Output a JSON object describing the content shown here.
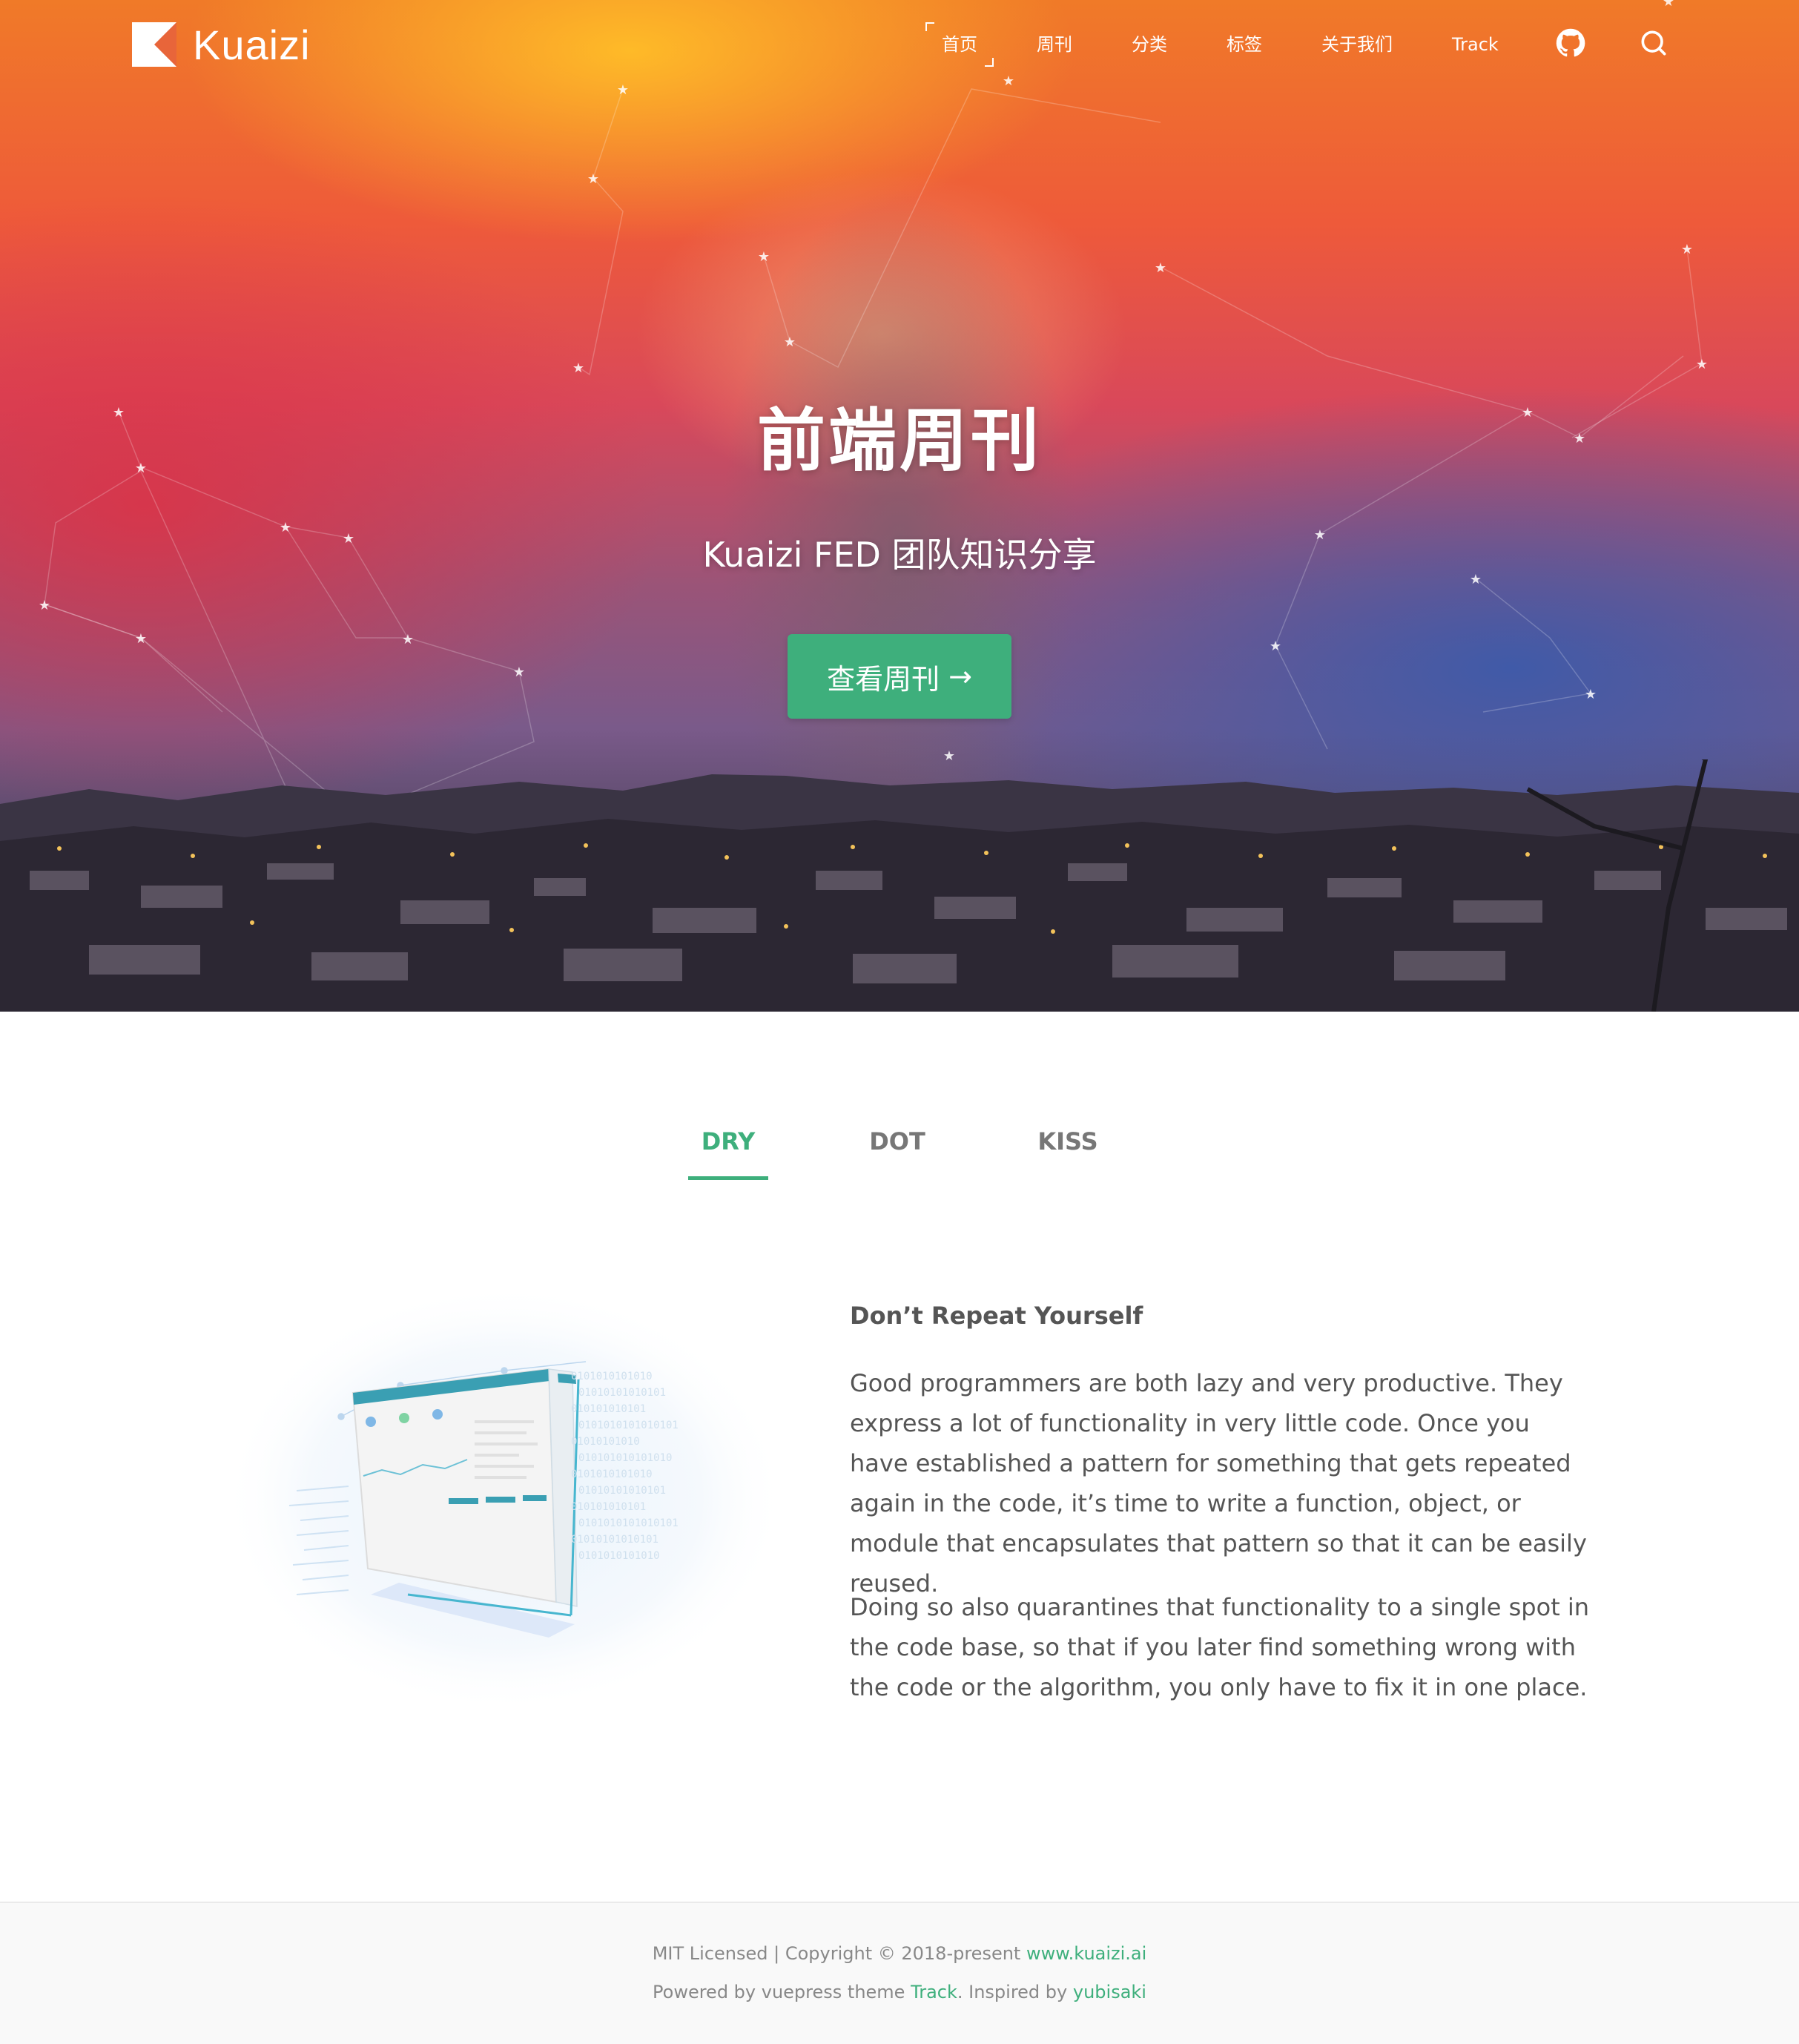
{
  "colors": {
    "accent": "#3eaf7c",
    "text": "#555555",
    "footer_bg": "#f9f9f9"
  },
  "header": {
    "brand": "Kuaizi",
    "nav": [
      {
        "label": "首页",
        "active": true
      },
      {
        "label": "周刊"
      },
      {
        "label": "分类"
      },
      {
        "label": "标签"
      },
      {
        "label": "关于我们"
      },
      {
        "label": "Track"
      }
    ],
    "icons": [
      "github-icon",
      "search-icon"
    ]
  },
  "hero": {
    "title": "前端周刊",
    "subtitle": "Kuaizi FED 团队知识分享",
    "button_label": "查看周刊",
    "button_arrow": "→"
  },
  "tabs": [
    {
      "label": "DRY",
      "active": true
    },
    {
      "label": "DOT"
    },
    {
      "label": "KISS"
    }
  ],
  "feature": {
    "title": "Don’t Repeat Yourself",
    "paragraphs": [
      "Good programmers are both lazy and very productive. They express a lot of functionality in very little code. Once you have established a pattern for something that gets repeated again in the code, it’s time to write a function, object, or module that encapsulates that pattern so that it can be easily reused.",
      "Doing so also quarantines that functionality to a single spot in the code base, so that if you later find something wrong with the code or the algorithm, you only have to fix it in one place."
    ],
    "illustration_binary": [
      "0101010101010",
      "01010101010101",
      "010101010101",
      "0101010101010101",
      "01010101010",
      "010101010101010",
      "0101010101010",
      "01010101010101",
      "010101010101",
      "0101010101010101",
      "01010101010101",
      "0101010101010"
    ]
  },
  "footer": {
    "line1_prefix": "MIT Licensed | Copyright © 2018-present ",
    "line1_link": "www.kuaizi.ai",
    "line2_prefix": "Powered by vuepress theme ",
    "line2_link1": "Track",
    "line2_middle": ". Inspired by ",
    "line2_link2": "yubisaki"
  }
}
